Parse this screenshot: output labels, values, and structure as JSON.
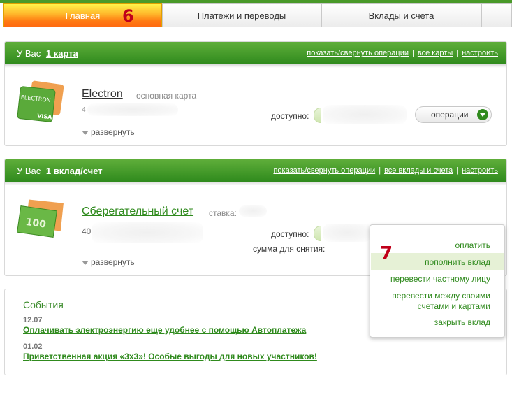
{
  "tabs": [
    {
      "label": "Главная",
      "marker": "6"
    },
    {
      "label": "Платежи и переводы"
    },
    {
      "label": "Вклады и счета"
    }
  ],
  "cards_panel": {
    "prefix": "У Вас",
    "count_link": "1 карта",
    "links": [
      "показать/свернуть операции",
      "все карты",
      "настроить"
    ],
    "card": {
      "name": "Electron",
      "subtitle": "основная карта",
      "number_prefix": "4",
      "available_label": "доступно:",
      "ops_button": "операции",
      "expand": "развернуть",
      "image_text": "ELECTRON",
      "image_brand": "VISA"
    }
  },
  "deposits_panel": {
    "prefix": "У Вас",
    "count_link": "1 вклад/счет",
    "links": [
      "показать/свернуть операции",
      "все вклады и счета",
      "настроить"
    ],
    "account": {
      "name": "Сберегательный счет",
      "rate_label": "ставка:",
      "number_prefix": "40",
      "available_label": "доступно:",
      "withdraw_label": "сумма для снятия:",
      "expand": "развернуть",
      "image_text": "100"
    }
  },
  "dropdown": {
    "marker": "7",
    "items": [
      "оплатить",
      "пополнить вклад",
      "перевести частному лицу",
      "перевести между своими",
      "счетами и картами",
      "закрыть вклад"
    ]
  },
  "events": {
    "title": "События",
    "items": [
      {
        "date": "12.07",
        "text": "Оплачивать электроэнергию еще удобнее с помощью Автоплатежа"
      },
      {
        "date": "01.02",
        "text": "Приветственная акция «3х3»! Особые выгоды для новых участников!"
      }
    ]
  },
  "colors": {
    "green": "#2f8a1d",
    "header_green": "#3f9a28",
    "active_tab": "#ff8a1a",
    "marker_red": "#c0001a"
  }
}
